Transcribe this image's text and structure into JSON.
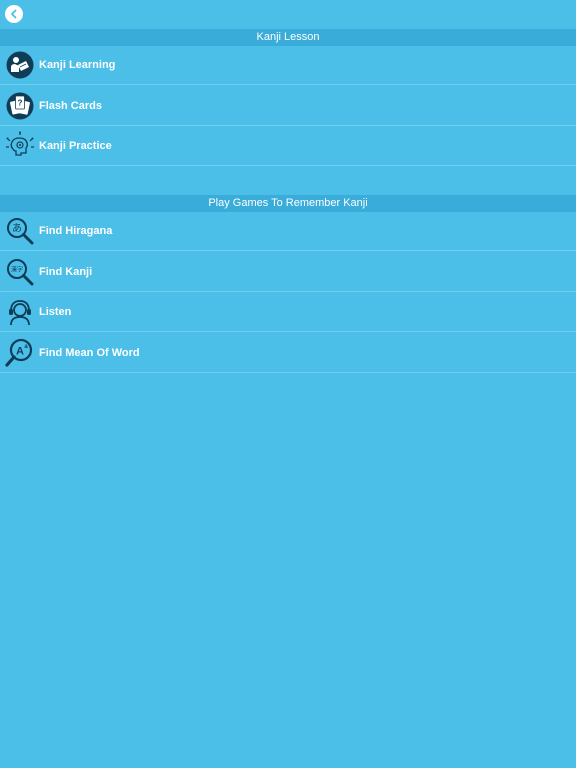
{
  "nav": {
    "back_icon": "chevron-left-icon"
  },
  "sections": [
    {
      "title": "Kanji Lesson",
      "items": [
        {
          "label": "Kanji Learning",
          "icon": "reading-book-icon"
        },
        {
          "label": "Flash Cards",
          "icon": "flash-cards-icon"
        },
        {
          "label": "Kanji Practice",
          "icon": "brain-gear-icon"
        }
      ]
    },
    {
      "title": "Play Games To Remember Kanji",
      "items": [
        {
          "label": "Find Hiragana",
          "icon": "magnifier-hiragana-icon",
          "glyph": "あ"
        },
        {
          "label": "Find Kanji",
          "icon": "magnifier-kanji-icon",
          "glyph": "漢字"
        },
        {
          "label": "Listen",
          "icon": "headset-icon"
        },
        {
          "label": "Find Mean Of Word",
          "icon": "magnifier-word-icon",
          "glyph": "A"
        }
      ]
    }
  ],
  "colors": {
    "background": "#4bbfe8",
    "header": "#39acd9",
    "text": "#ffffff",
    "icon_dark": "#0f3d57"
  }
}
